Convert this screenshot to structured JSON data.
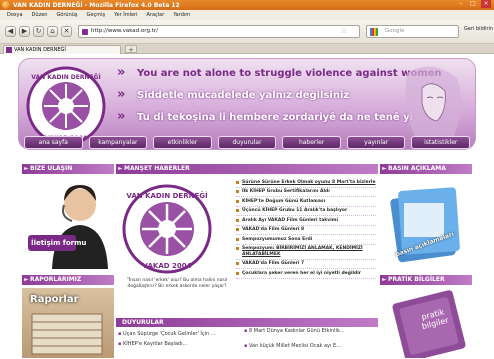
{
  "browser": {
    "window_title": "VAN KADIN DERNEĞİ - Mozilla Firefox 4.0 Beta 12",
    "menu": [
      "Dosya",
      "Düzen",
      "Görünüş",
      "Geçmiş",
      "Yer İmleri",
      "Araçlar",
      "Yardım"
    ],
    "url": "http://www.vakad.org.tr/",
    "search_placeholder": "Google",
    "geri_label": "Geri bildirin",
    "tab_title": "VAN KADIN DERNEĞİ",
    "new_tab_label": "+"
  },
  "header": {
    "slogans": [
      "You are not alone to struggle violence against women",
      "Şiddetle mücadelede  yalnız değilsiniz",
      "Tu di tekoşina li hembere zordariyê da ne tenê yî"
    ],
    "logo_top_text": "VAN KADIN DERNEĞİ",
    "logo_bottom_text": "VAKAD 2004"
  },
  "nav": [
    "ana sayfa",
    "kampanyalar",
    "etkinlikler",
    "duyurular",
    "haberler",
    "yayınlar",
    "istatistikler"
  ],
  "left": {
    "bize_ulasin": "BİZE ULAŞIN",
    "iletisim": "İletişim formu",
    "raporlar": "RAPORLARIMIZ",
    "raporlar_img": "Raporlar"
  },
  "middle": {
    "manset_title": "MANŞET HABERLER",
    "caption": "\"İnsan nasıl 'erkek' olur? Bu olma halini nasıl doğallaştırır? Bir erkek askerde neler yaşar?",
    "news": [
      {
        "text": "Sürüne Sürüne Erkek Olmak oyunu 8 Mart'ta bizlerle",
        "ul": true
      },
      {
        "text": "İlk KİHEP Grubu Sertifikalarını Aldı",
        "ul": false
      },
      {
        "text": "KİHEP'te Doğum Günü Kutlaması",
        "ul": false
      },
      {
        "text": "Üçüncü KİHEP Grubu 11 Aralık'ta başlıyor",
        "ul": false
      },
      {
        "text": "Aralık Ayı VAKAD Film Günleri takvimi",
        "ul": false
      },
      {
        "text": "VAKAD'da Film Günleri 8",
        "ul": false
      },
      {
        "text": "Sempozyumumuz Sona Erdi",
        "ul": false
      },
      {
        "text": "Sempozyum: BİRBİRİMİZİ ANLAMAK, KENDİMİZİ ANLATABİLMEK",
        "ul": true
      },
      {
        "text": "VAKAD'da Film Günleri 7",
        "ul": false
      },
      {
        "text": "Çocuklara şeker veren her el iyi niyetli değildir",
        "ul": false
      }
    ],
    "duyurular_title": "DUYURULAR",
    "duyurular": [
      "Uçan Süpürge 'Çocuk Gelinler' İçin ...",
      "8 Mart Dünya Kadınlar Günü Etkinlik...",
      "KİHEP'e Kayıtlar Başladı...",
      "Van küçük Millet Meclisi Ocak ayı E..."
    ]
  },
  "right": {
    "basin": "BASIN AÇIKLAMA",
    "basin_img": "basın açıklamaları",
    "pratik": "PRATİK BİLGİLER",
    "pratik_img": "pratik bilgiler"
  },
  "colors": {
    "brand": "#8d3b97",
    "accent": "#c0841f"
  }
}
